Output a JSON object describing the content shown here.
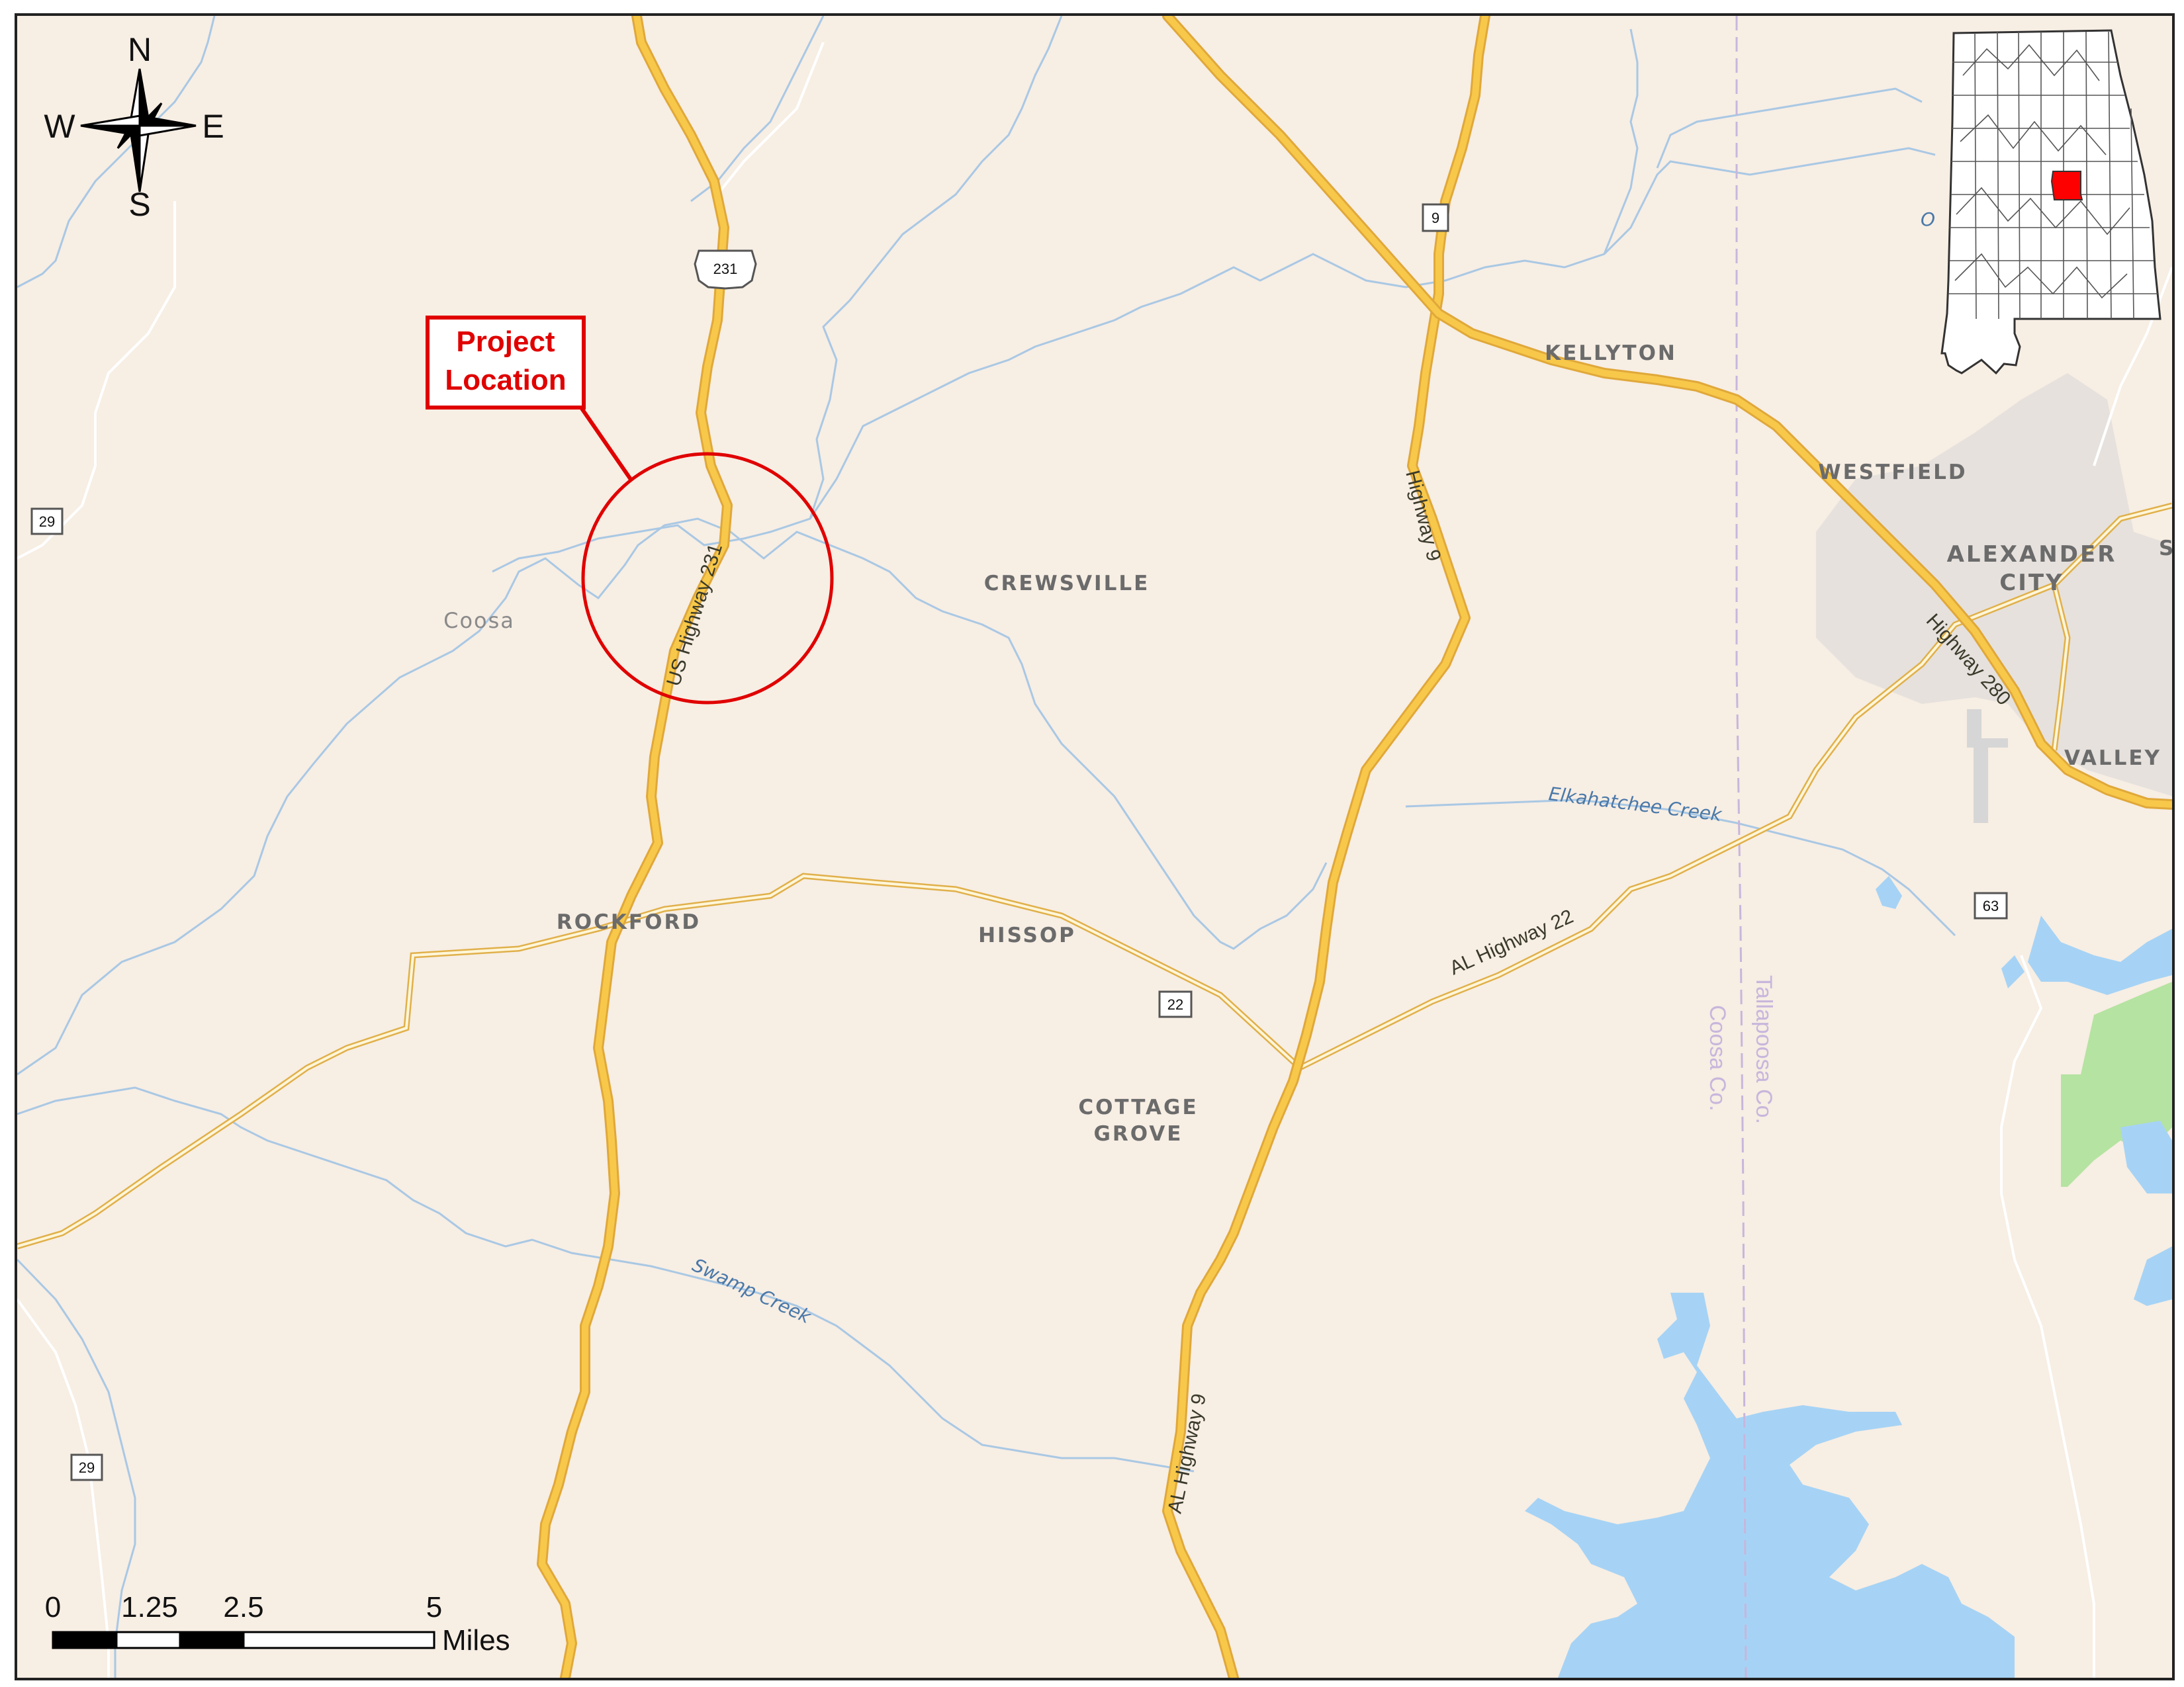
{
  "compass": {
    "n": "N",
    "s": "S",
    "e": "E",
    "w": "W"
  },
  "callout": {
    "line1": "Project",
    "line2": "Location"
  },
  "towns": {
    "kellyton": "KELLYTON",
    "westfield": "WESTFIELD",
    "alexander": "ALEXANDER",
    "city": "CITY",
    "crewsville": "CREWSVILLE",
    "rockford": "ROCKFORD",
    "hissop": "HISSOP",
    "cottage": "COTTAGE",
    "grove": "GROVE",
    "valley": "VALLEY",
    "coosa": "Coosa",
    "s_partial": "S"
  },
  "roads": {
    "us231": "US Highway 231",
    "hwy9": "Highway 9",
    "al9": "AL Highway 9",
    "hwy280": "Highway 280",
    "al22": "AL Highway 22"
  },
  "shields": {
    "s231": "231",
    "s9": "9",
    "s29a": "29",
    "s29b": "29",
    "s22": "22",
    "s63": "63"
  },
  "water": {
    "elkahatchee": "Elkahatchee Creek",
    "swamp": "Swamp Creek",
    "o_partial": "O"
  },
  "counties": {
    "tallapoosa": "Tallapoosa Co.",
    "coosa": "Coosa Co."
  },
  "scale": {
    "t0": "0",
    "t1": "1.25",
    "t2": "2.5",
    "t3": "5",
    "unit": "Miles"
  },
  "colors": {
    "background": "#f7eee4",
    "highway": "#f5c542",
    "highway_casing": "#e0a83a",
    "minor_road": "#f5c542",
    "stream": "#a9c8e4",
    "lake": "#a6d3f5",
    "park": "#b5e3a1",
    "urban": "#e6e1dd",
    "county_line": "#c8b6dc",
    "callout": "#e00000",
    "inset_highlight": "#ff0000"
  }
}
